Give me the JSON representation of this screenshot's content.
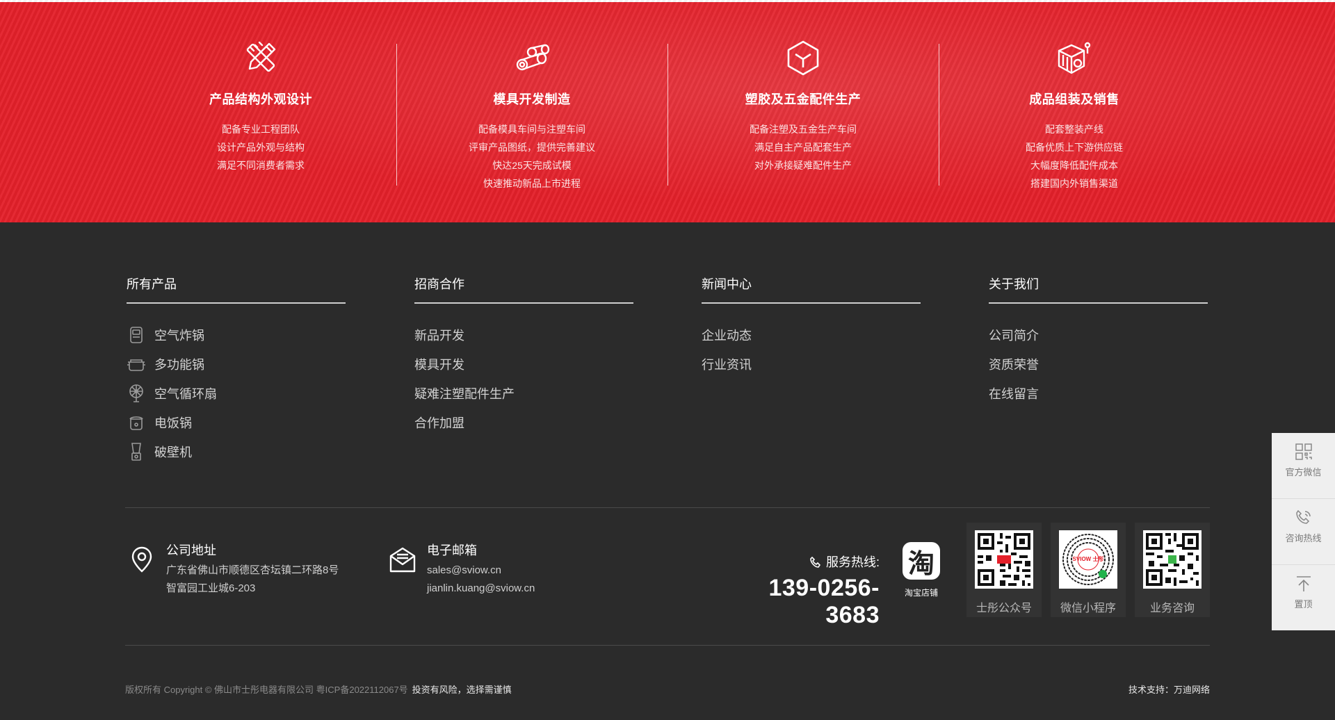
{
  "services": [
    {
      "icon": "pencil-ruler-icon",
      "title": "产品结构外观设计",
      "lines": [
        "配备专业工程团队",
        "设计产品外观与结构",
        "满足不同消费者需求"
      ]
    },
    {
      "icon": "pipes-icon",
      "title": "模具开发制造",
      "lines": [
        "配备模具车间与注塑车间",
        "评审产品图纸，提供完善建议",
        "快达25天完成试模",
        "快速推动新品上市进程"
      ]
    },
    {
      "icon": "box-icon",
      "title": "塑胶及五金配件生产",
      "lines": [
        "配备注塑及五金生产车间",
        "满足自主产品配套生产",
        "对外承接疑难配件生产"
      ]
    },
    {
      "icon": "cube-gear-icon",
      "title": "成品组装及销售",
      "lines": [
        "配套整装产线",
        "配备优质上下游供应链",
        "大幅度降低配件成本",
        "搭建国内外销售渠道"
      ]
    }
  ],
  "nav": [
    {
      "heading": "所有产品",
      "items": [
        {
          "label": "空气炸锅",
          "icon": "air-fryer-icon"
        },
        {
          "label": "多功能锅",
          "icon": "multi-cooker-icon"
        },
        {
          "label": "空气循环扇",
          "icon": "fan-icon"
        },
        {
          "label": "电饭锅",
          "icon": "rice-cooker-icon"
        },
        {
          "label": "破壁机",
          "icon": "blender-icon"
        }
      ]
    },
    {
      "heading": "招商合作",
      "items": [
        {
          "label": "新品开发"
        },
        {
          "label": "模具开发"
        },
        {
          "label": "疑难注塑配件生产"
        },
        {
          "label": "合作加盟"
        }
      ]
    },
    {
      "heading": "新闻中心",
      "items": [
        {
          "label": "企业动态"
        },
        {
          "label": "行业资讯"
        }
      ]
    },
    {
      "heading": "关于我们",
      "items": [
        {
          "label": "公司简介"
        },
        {
          "label": "资质荣誉"
        },
        {
          "label": "在线留言"
        }
      ]
    }
  ],
  "contact": {
    "address_label": "公司地址",
    "address_line1": "广东省佛山市顺德区杏坛镇二环路8号",
    "address_line2": "智富园工业城6-203",
    "email_label": "电子邮箱",
    "email1": "sales@sviow.cn",
    "email2": "jianlin.kuang@sviow.cn",
    "hotline_label": "服务热线:",
    "hotline_number": "139-0256-3683",
    "taobao_glyph": "淘",
    "taobao_label": "淘宝店铺"
  },
  "qrcodes": [
    {
      "label": "士彤公众号"
    },
    {
      "label": "微信小程序",
      "center_text": "SVIOW 士彤"
    },
    {
      "label": "业务咨询"
    }
  ],
  "footer": {
    "copyright": "版权所有 Copyright © 佛山市士彤电器有限公司 粤ICP备2022112067号",
    "risk": "投资有风险，选择需谨慎",
    "tech": "技术支持：万迪网络"
  },
  "sidebar": [
    {
      "label": "官方微信",
      "icon": "qrcode-icon"
    },
    {
      "label": "咨询热线",
      "icon": "phone-icon"
    },
    {
      "label": "置顶",
      "icon": "back-to-top-icon"
    }
  ],
  "colors": {
    "brand_red": "#e4202a",
    "footer_bg": "#2b2b2b",
    "sidebar_bg": "#efefef"
  }
}
